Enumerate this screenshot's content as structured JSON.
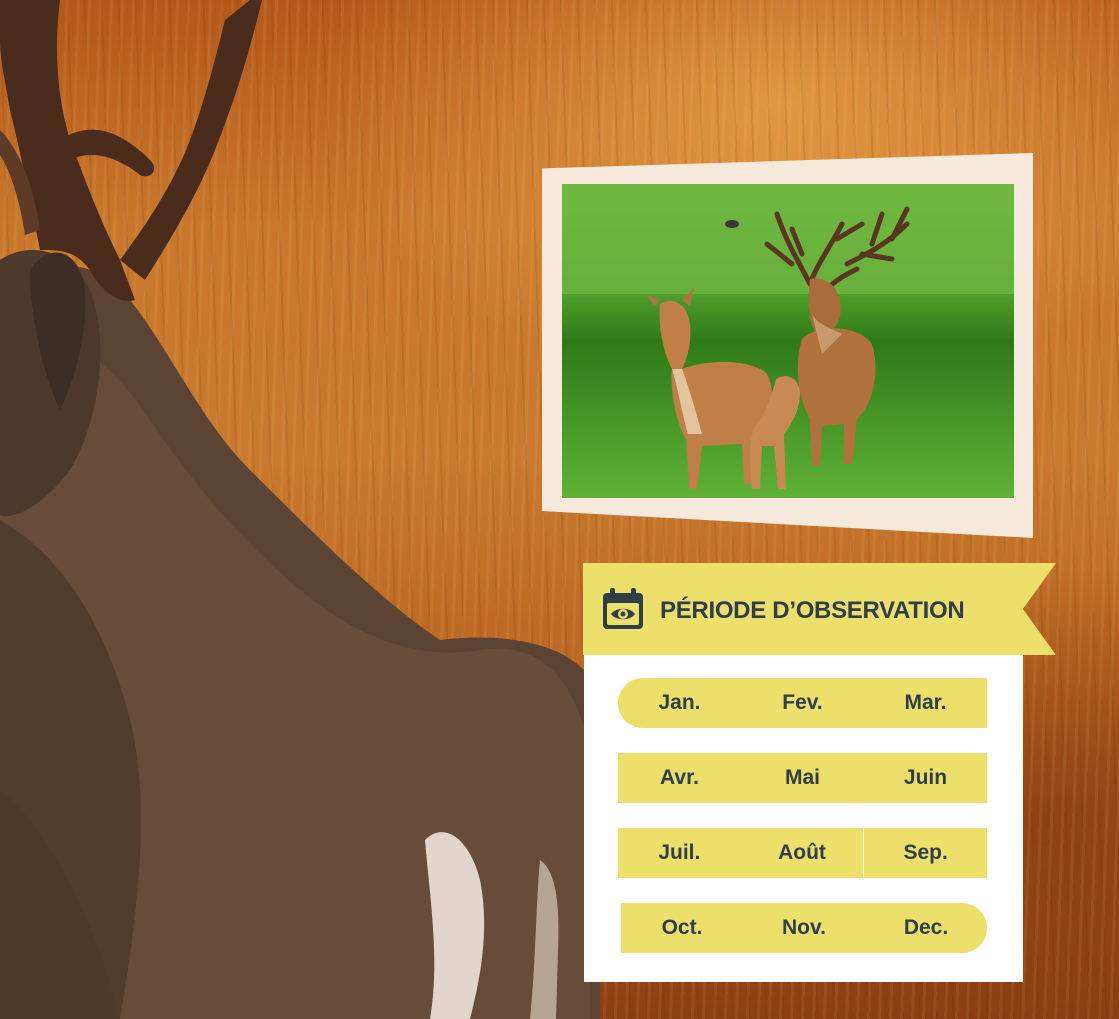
{
  "period": {
    "title": "PÉRIODE D’OBSERVATION",
    "icon": "calendar-eye-icon",
    "months": [
      [
        "Jan.",
        "Fev.",
        "Mar."
      ],
      [
        "Avr.",
        "Mai",
        "Juin"
      ],
      [
        "Juil.",
        "Août",
        "Sep."
      ],
      [
        "Oct.",
        "Nov.",
        "Dec."
      ]
    ]
  },
  "colors": {
    "accent": "#ece06a",
    "text": "#2f3e49",
    "card": "#ffffff",
    "frame": "#f6e9dc"
  }
}
